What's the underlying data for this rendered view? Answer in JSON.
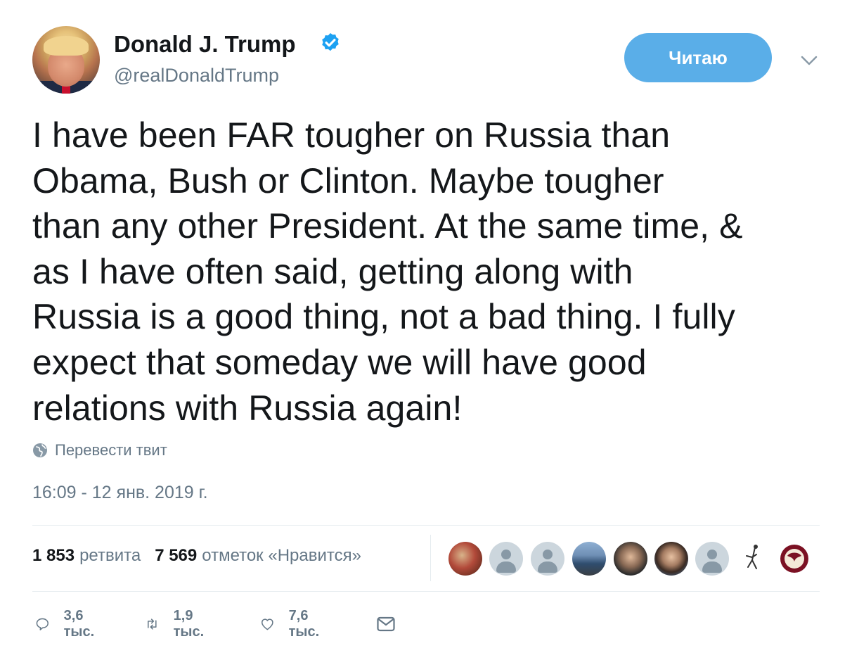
{
  "user": {
    "display_name": "Donald J. Trump",
    "handle": "@realDonaldTrump",
    "verified": true,
    "verified_icon": "verified-badge-icon",
    "verified_color": "#1da1f2"
  },
  "follow_button": {
    "label": "Читаю",
    "color": "#5aaee8"
  },
  "tweet": {
    "text": "I have been FAR tougher on Russia than\nObama, Bush or Clinton. Maybe tougher\nthan any other President. At the same time, &\nas I have often said, getting along with\nRussia is a good thing, not a bad thing. I fully\nexpect that someday we will have good\nrelations with Russia again!",
    "translate_label": "Перевести твит",
    "timestamp": "16:09 - 12 янв. 2019 г."
  },
  "stats": {
    "retweets_count": "1 853",
    "retweets_label": "ретвита",
    "likes_count": "7 569",
    "likes_label": "отметок «Нравится»"
  },
  "likers": [
    {
      "icon": "liker-avatar-photo"
    },
    {
      "icon": "default-avatar-icon"
    },
    {
      "icon": "default-avatar-icon"
    },
    {
      "icon": "liker-avatar-photo"
    },
    {
      "icon": "liker-avatar-photo"
    },
    {
      "icon": "liker-avatar-photo"
    },
    {
      "icon": "default-avatar-icon"
    },
    {
      "icon": "liker-avatar-drawing"
    },
    {
      "icon": "liker-avatar-logo"
    }
  ],
  "actions": {
    "reply_count": "3,6 тыс.",
    "retweet_count": "1,9 тыс.",
    "like_count": "7,6 тыс.",
    "icons": [
      "reply-icon",
      "retweet-icon",
      "like-icon",
      "direct-message-icon"
    ]
  },
  "colors": {
    "text_primary": "#14171a",
    "text_secondary": "#657786",
    "divider": "#e6ecf0",
    "accent": "#1da1f2"
  }
}
